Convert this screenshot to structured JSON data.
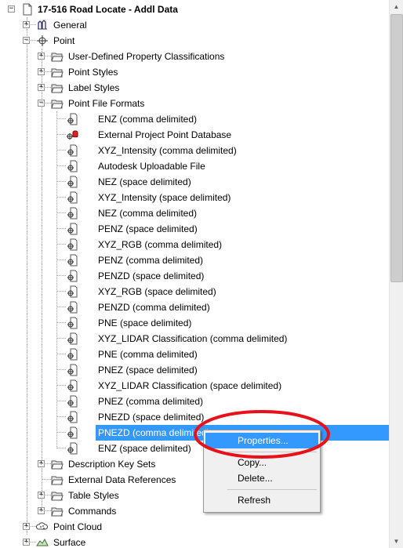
{
  "colors": {
    "selection": "#3399ff",
    "annotation_ellipse": "#e8101a",
    "menu_background": "#f0f0f0"
  },
  "tree": {
    "root": {
      "label": "17-516 Road Locate - Addl Data",
      "icon": "drawing-page-icon",
      "expanded": true
    },
    "nodes": [
      {
        "label": "General",
        "icon": "general-settings-icon",
        "expanded": false
      },
      {
        "label": "Point",
        "icon": "point-node-icon",
        "expanded": true
      },
      {
        "label": "User-Defined Property Classifications",
        "icon": "folder-icon",
        "expanded": false
      },
      {
        "label": "Point Styles",
        "icon": "folder-icon",
        "expanded": false
      },
      {
        "label": "Label Styles",
        "icon": "folder-icon",
        "expanded": false
      },
      {
        "label": "Point File Formats",
        "icon": "folder-icon",
        "expanded": true
      },
      {
        "label": "ENZ (comma delimited)",
        "icon": "point-file-format-icon"
      },
      {
        "label": "External Project Point Database",
        "icon": "external-database-icon"
      },
      {
        "label": "XYZ_Intensity (comma delimited)",
        "icon": "point-file-format-icon"
      },
      {
        "label": "Autodesk Uploadable File",
        "icon": "point-file-format-icon"
      },
      {
        "label": "NEZ (space delimited)",
        "icon": "point-file-format-icon"
      },
      {
        "label": "XYZ_Intensity (space delimited)",
        "icon": "point-file-format-icon"
      },
      {
        "label": "NEZ (comma delimited)",
        "icon": "point-file-format-icon"
      },
      {
        "label": "PENZ (space delimited)",
        "icon": "point-file-format-icon"
      },
      {
        "label": "XYZ_RGB (comma delimited)",
        "icon": "point-file-format-icon"
      },
      {
        "label": "PENZ (comma delimited)",
        "icon": "point-file-format-icon"
      },
      {
        "label": "PENZD (space delimited)",
        "icon": "point-file-format-icon"
      },
      {
        "label": "XYZ_RGB (space delimited)",
        "icon": "point-file-format-icon"
      },
      {
        "label": "PENZD (comma delimited)",
        "icon": "point-file-format-icon"
      },
      {
        "label": "PNE (space delimited)",
        "icon": "point-file-format-icon"
      },
      {
        "label": "XYZ_LIDAR Classification (comma delimited)",
        "icon": "point-file-format-icon"
      },
      {
        "label": "PNE (comma delimited)",
        "icon": "point-file-format-icon"
      },
      {
        "label": "PNEZ (space delimited)",
        "icon": "point-file-format-icon"
      },
      {
        "label": "XYZ_LIDAR Classification (space delimited)",
        "icon": "point-file-format-icon"
      },
      {
        "label": "PNEZ (comma delimited)",
        "icon": "point-file-format-icon"
      },
      {
        "label": "PNEZD (space delimited)",
        "icon": "point-file-format-icon"
      },
      {
        "label": "PNEZD (comma delimited)",
        "icon": "point-file-format-icon",
        "selected": true
      },
      {
        "label": "ENZ (space delimited)",
        "icon": "point-file-format-icon"
      },
      {
        "label": "Description Key Sets",
        "icon": "folder-icon",
        "expanded": false
      },
      {
        "label": "External Data References",
        "icon": "folder-icon"
      },
      {
        "label": "Table Styles",
        "icon": "folder-icon",
        "expanded": false
      },
      {
        "label": "Commands",
        "icon": "folder-icon",
        "expanded": false
      },
      {
        "label": "Point Cloud",
        "icon": "point-cloud-icon",
        "expanded": false
      },
      {
        "label": "Surface",
        "icon": "surface-icon",
        "expanded": false
      }
    ]
  },
  "context_menu": {
    "items": [
      {
        "label": "Properties...",
        "highlighted": true
      },
      {
        "label": "Copy..."
      },
      {
        "label": "Delete..."
      },
      {
        "label": "Refresh"
      }
    ]
  }
}
